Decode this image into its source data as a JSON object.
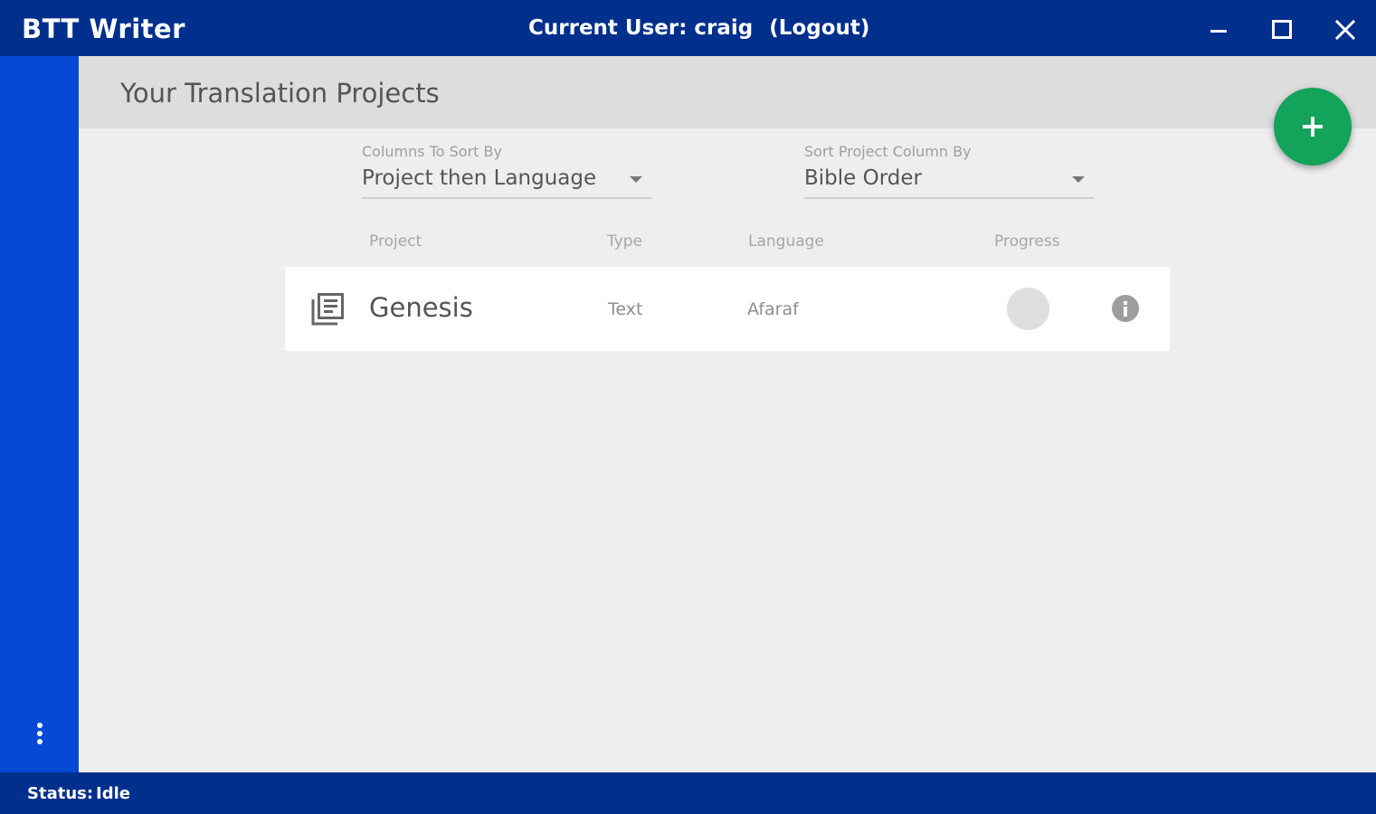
{
  "app": {
    "title": "BTT Writer",
    "current_user_label": "Current User: craig",
    "logout_label": "(Logout)"
  },
  "window_controls": [
    "minimize-icon",
    "maximize-icon",
    "close-icon"
  ],
  "page": {
    "title": "Your Translation Projects",
    "add_button_icon": "plus-icon"
  },
  "sort": {
    "columns_label": "Columns To Sort By",
    "columns_value": "Project then Language",
    "order_label": "Sort Project Column By",
    "order_value": "Bible Order"
  },
  "table": {
    "headers": {
      "project": "Project",
      "type": "Type",
      "language": "Language",
      "progress": "Progress"
    },
    "rows": [
      {
        "icon": "book-stack-icon",
        "project": "Genesis",
        "type": "Text",
        "language": "Afaraf",
        "progress": 0,
        "info_icon": "info-icon"
      }
    ]
  },
  "status": {
    "label": "Status:",
    "value": "Idle"
  },
  "colors": {
    "titlebar": "#012f8c",
    "sidebar": "#0549d4",
    "fab": "#13a35b",
    "background": "#eeeeee"
  }
}
